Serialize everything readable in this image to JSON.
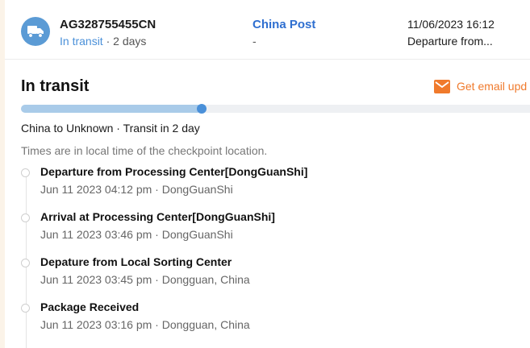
{
  "summary": {
    "tracking_number": "AG328755455CN",
    "status_label": "In transit",
    "status_duration": "· 2 days",
    "carrier_name": "China Post",
    "carrier_sub": "-",
    "last_update_time": "11/06/2023 16:12",
    "last_event": "Departure from..."
  },
  "detail": {
    "title": "In transit",
    "email_label": "Get email upd",
    "progress_fraction": 0.35,
    "route": "China to Unknown · Transit in 2 day",
    "timezone_note": "Times are in local time of the checkpoint location."
  },
  "events": [
    {
      "description": "Departure from Processing Center[DongGuanShi]",
      "meta": "Jun 11 2023 04:12 pm · DongGuanShi"
    },
    {
      "description": "Arrival at Processing Center[DongGuanShi]",
      "meta": "Jun 11 2023 03:46 pm · DongGuanShi"
    },
    {
      "description": "Depature from Local Sorting Center",
      "meta": "Jun 11 2023 03:45 pm · Dongguan, China"
    },
    {
      "description": "Package Received",
      "meta": "Jun 11 2023 03:16 pm · Dongguan, China"
    }
  ],
  "icons": {
    "truck": "truck-icon",
    "mail": "mail-icon"
  },
  "colors": {
    "accent_blue": "#4a90d9",
    "carrier_blue": "#2f6fd0",
    "email_orange": "#f07a2c",
    "progress_fill": "#a9cbe9"
  }
}
